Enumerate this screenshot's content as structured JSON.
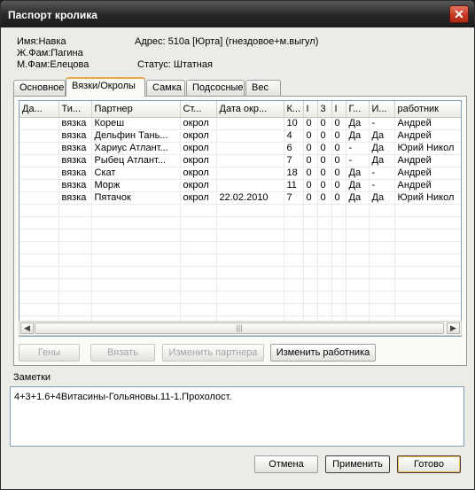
{
  "window": {
    "title": "Паспорт кролика",
    "close_glyph": "✕"
  },
  "info": {
    "name": "Имя:Навка",
    "male_line": "Ж.Фам:Пагина",
    "female_line": "М.Фам:Елецова",
    "address": "Адрес: 510а [Юрта] (гнездовое+м.выгул)",
    "status": "Статус: Штатная"
  },
  "tabs": [
    {
      "label": "Основное"
    },
    {
      "label": "Вязки/Окролы"
    },
    {
      "label": "Самка"
    },
    {
      "label": "Подсосные"
    },
    {
      "label": "Вес"
    }
  ],
  "grid": {
    "columns": [
      "Да...",
      "Ти...",
      "Партнер",
      "Ст...",
      "Дата окр...",
      "К...",
      "I",
      "3",
      "I",
      "Г...",
      "И...",
      "работник"
    ],
    "rows": [
      [
        "",
        "вязка",
        "Кореш",
        "окрол",
        "",
        "10",
        "0",
        "0",
        "0",
        "Да",
        "-",
        "Андрей"
      ],
      [
        "",
        "вязка",
        "Дельфин Тань...",
        "окрол",
        "",
        "4",
        "0",
        "0",
        "0",
        "Да",
        "Да",
        "Андрей"
      ],
      [
        "",
        "вязка",
        "Хариус Атлант...",
        "окрол",
        "",
        "6",
        "0",
        "0",
        "0",
        "-",
        "Да",
        "Юрий Никол"
      ],
      [
        "",
        "вязка",
        "Рыбец Атлант...",
        "окрол",
        "",
        "7",
        "0",
        "0",
        "0",
        "-",
        "Да",
        "Андрей"
      ],
      [
        "",
        "вязка",
        "Скат",
        "окрол",
        "",
        "18",
        "0",
        "0",
        "0",
        "Да",
        "-",
        "Андрей"
      ],
      [
        "",
        "вязка",
        "Морж",
        "окрол",
        "",
        "11",
        "0",
        "0",
        "0",
        "Да",
        "-",
        "Андрей"
      ],
      [
        "",
        "вязка",
        "Пятачок",
        "окрол",
        "22.02.2010",
        "7",
        "0",
        "0",
        "0",
        "Да",
        "Да",
        "Юрий Никол"
      ]
    ],
    "scroll_left": "◀",
    "scroll_right": "▶",
    "scroll_grip": "|||"
  },
  "actions": {
    "genes": "Гены",
    "mate": "Вязать",
    "change_partner": "Изменить партнера",
    "change_worker": "Изменить работника"
  },
  "notes": {
    "label": "Заметки",
    "text": "4+3+1.6+4Витасины-Гольяновы.11-1.Прохолост."
  },
  "footer": {
    "cancel": "Отмена",
    "apply": "Применить",
    "done": "Готово"
  }
}
